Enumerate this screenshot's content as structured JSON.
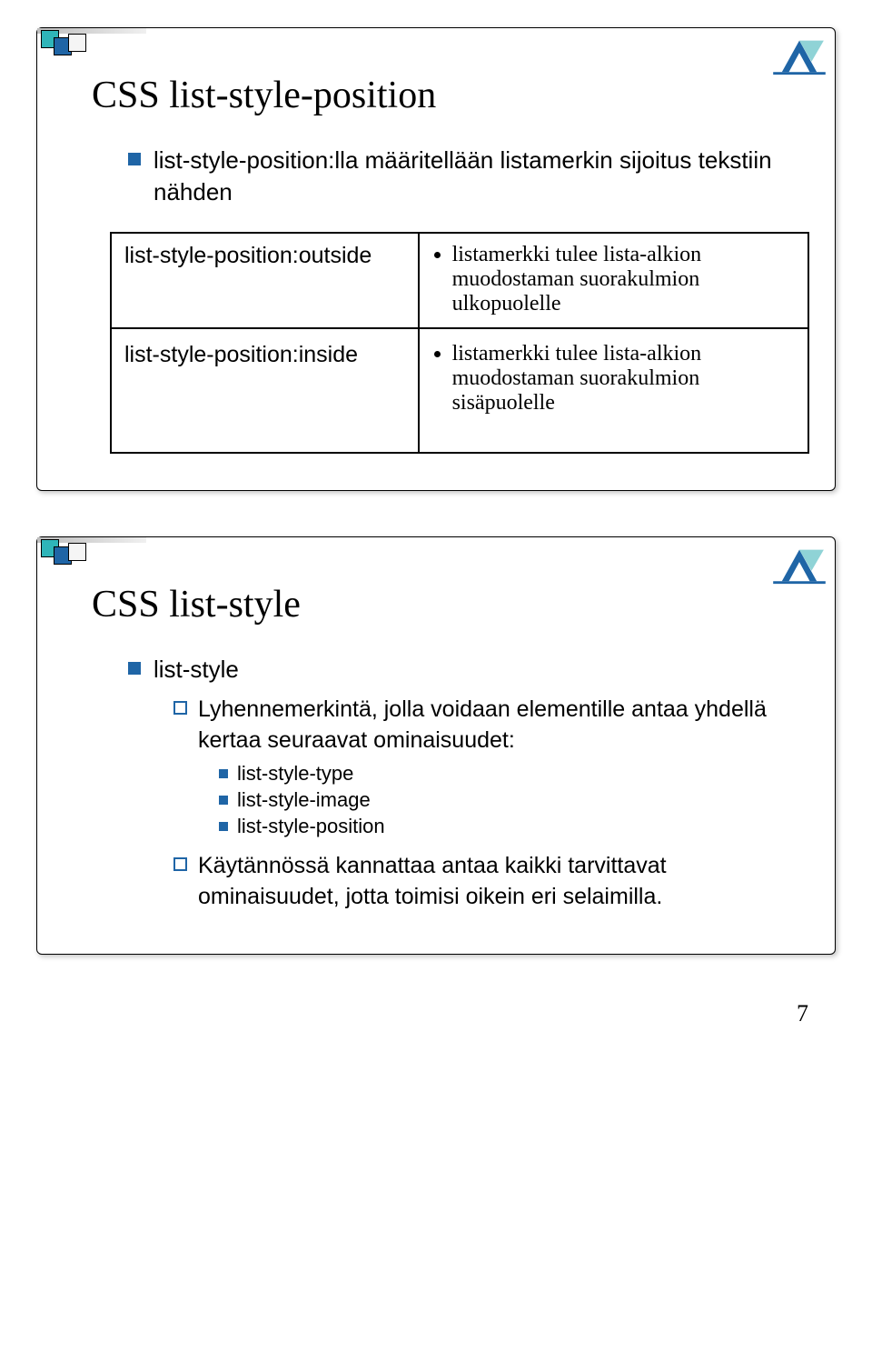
{
  "slide1": {
    "title": "CSS list-style-position",
    "bullet": "list-style-position:lla määritellään listamerkin sijoitus tekstiin nähden",
    "table": {
      "row1": {
        "left": "list-style-position:outside",
        "right_lead": "listamerkki tulee lista-alkion",
        "right_l2": "muodostaman suorakulmion",
        "right_l3": "ulkopuolelle"
      },
      "row2": {
        "left": "list-style-position:inside",
        "right_lead": "listamerkki tulee lista-alkion",
        "right_l2": "muodostaman suorakulmion",
        "right_l3": "sisäpuolelle"
      }
    }
  },
  "slide2": {
    "title": "CSS list-style",
    "bullet": "list-style",
    "sub1": "Lyhennemerkintä, jolla voidaan elementille antaa yhdellä kertaa seuraavat ominaisuudet:",
    "deep": {
      "d1": "list-style-type",
      "d2": "list-style-image",
      "d3": "list-style-position"
    },
    "sub2": "Käytännössä kannattaa antaa kaikki tarvittavat ominaisuudet, jotta toimisi oikein eri selaimilla."
  },
  "page_number": "7"
}
